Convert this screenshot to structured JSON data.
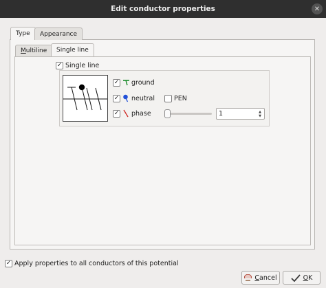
{
  "window": {
    "title": "Edit conductor properties",
    "close_glyph": "✕"
  },
  "tabs": [
    {
      "label": "Type",
      "active": true
    },
    {
      "label": "Appearance",
      "active": false
    }
  ],
  "subtabs": [
    {
      "label_underlined": "M",
      "label_rest": "ultiline",
      "active": false
    },
    {
      "label": "Single line",
      "active": true
    }
  ],
  "single_line": {
    "checkbox_label": "Single line",
    "checked": true,
    "ground": {
      "label": "ground",
      "checked": true,
      "icon": "ground-icon",
      "color": "#1a8a2a"
    },
    "neutral": {
      "label": "neutral",
      "checked": true,
      "icon": "neutral-icon",
      "color": "#2150d8"
    },
    "pen": {
      "label": "PEN",
      "checked": false
    },
    "phase": {
      "label": "phase",
      "checked": true,
      "icon": "phase-icon",
      "color": "#d0312d"
    },
    "phase_count": "1",
    "slider_fraction": 0.0
  },
  "apply_all": {
    "label": "Apply properties to all conductors of this potential",
    "checked": true
  },
  "buttons": {
    "cancel": {
      "label_underlined": "C",
      "label_rest": "ancel",
      "icon": "cancel-icon"
    },
    "ok": {
      "label_underlined": "O",
      "label_rest": "K",
      "icon": "ok-icon"
    }
  },
  "check_glyph": "✓"
}
